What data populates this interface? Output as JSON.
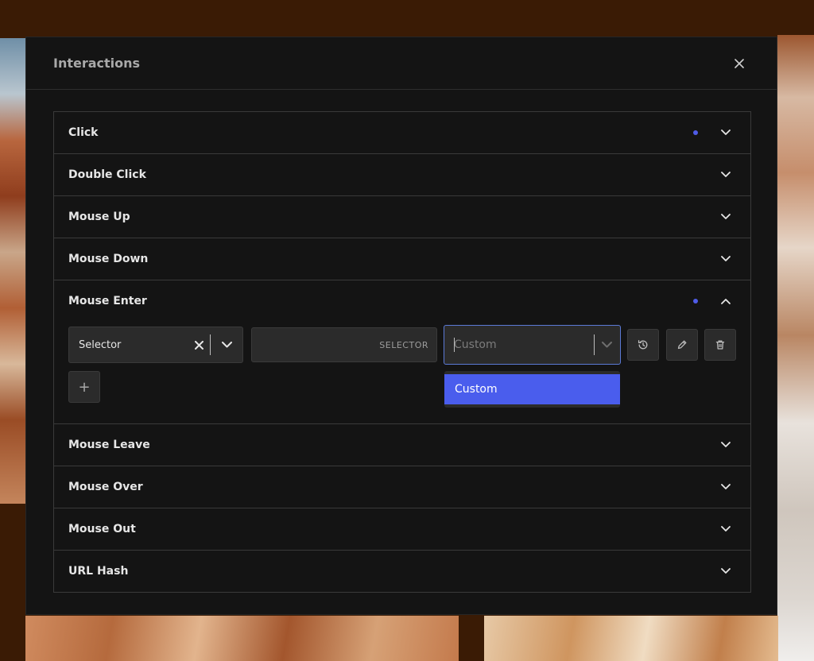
{
  "modal": {
    "title": "Interactions",
    "close_icon": "close-icon"
  },
  "accent_color": "#4f5ce8",
  "events": [
    {
      "label": "Click",
      "has_indicator": true,
      "expanded": false
    },
    {
      "label": "Double Click",
      "has_indicator": false,
      "expanded": false
    },
    {
      "label": "Mouse Up",
      "has_indicator": false,
      "expanded": false
    },
    {
      "label": "Mouse Down",
      "has_indicator": false,
      "expanded": false
    },
    {
      "label": "Mouse Enter",
      "has_indicator": true,
      "expanded": true
    },
    {
      "label": "Mouse Leave",
      "has_indicator": false,
      "expanded": false
    },
    {
      "label": "Mouse Over",
      "has_indicator": false,
      "expanded": false
    },
    {
      "label": "Mouse Out",
      "has_indicator": false,
      "expanded": false
    },
    {
      "label": "URL Hash",
      "has_indicator": false,
      "expanded": false
    }
  ],
  "mouse_enter": {
    "target_type_value": "Selector",
    "selector_input_placeholder": "SELECTOR",
    "action_placeholder": "Custom",
    "dropdown_options": [
      "Custom"
    ],
    "icon_buttons": [
      "history-icon",
      "pencil-icon",
      "trash-icon"
    ],
    "add_label": "+"
  }
}
